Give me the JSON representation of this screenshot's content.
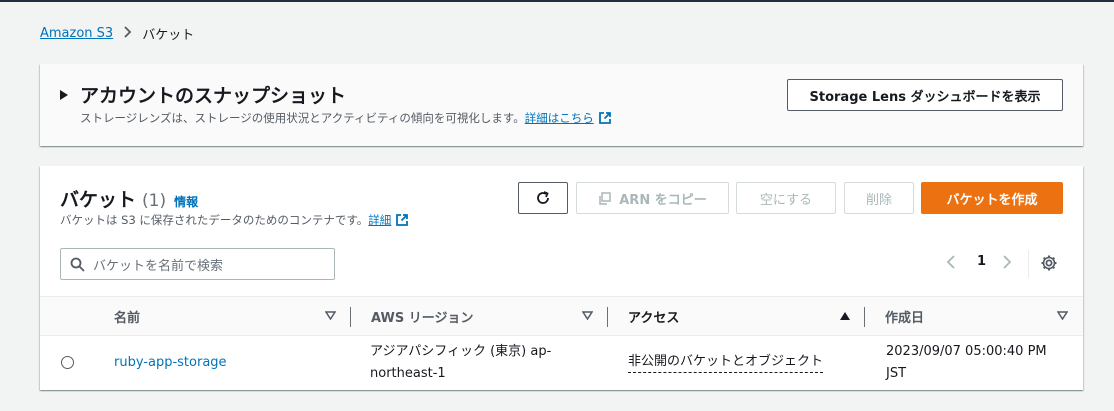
{
  "breadcrumb": {
    "root": "Amazon S3",
    "separator": "›",
    "current": "バケット"
  },
  "snapshot": {
    "title": "アカウントのスナップショット",
    "description": "ストレージレンズは、ストレージの使用状況とアクティビティの傾向を可視化します。",
    "learn_more": "詳細はこちら",
    "lens_button": "Storage Lens ダッシュボードを表示"
  },
  "buckets": {
    "title": "バケット",
    "count": "(1)",
    "info": "情報",
    "description": "バケットは S3 に保存されたデータのためのコンテナです。",
    "details_link": "詳細",
    "actions": {
      "copy_arn": "ARN をコピー",
      "empty": "空にする",
      "delete": "削除",
      "create": "バケットを作成"
    },
    "search_placeholder": "バケットを名前で検索",
    "pagination": {
      "prev": "‹",
      "page": "1",
      "next": "›"
    },
    "columns": [
      "名前",
      "AWS リージョン",
      "アクセス",
      "作成日"
    ],
    "rows": [
      {
        "name": "ruby-app-storage",
        "region": "アジアパシフィック (東京) ap-northeast-1",
        "access": "非公開のバケットとオブジェクト",
        "created": "2023/09/07 05:00:40 PM JST"
      }
    ]
  },
  "colors": {
    "link": "#0073bb",
    "primary": "#ec7211",
    "text": "#16191f"
  }
}
